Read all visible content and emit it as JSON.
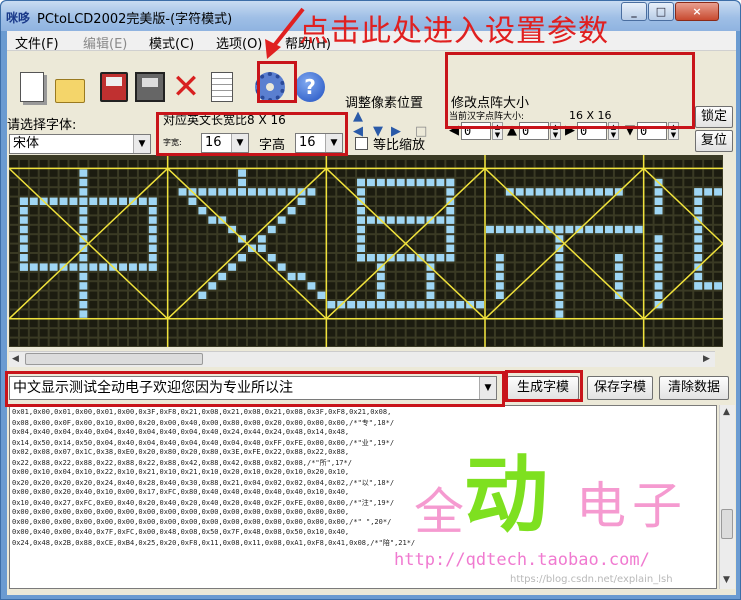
{
  "window": {
    "title": "PCtoLCD2002完美版-(字符模式)",
    "app_icon_text": "咪哆"
  },
  "menu": [
    {
      "label": "文件(F)",
      "enabled": true
    },
    {
      "label": "编辑(E)",
      "enabled": false
    },
    {
      "label": "模式(C)",
      "enabled": true
    },
    {
      "label": "选项(O)",
      "enabled": true
    },
    {
      "label": "帮助(H)",
      "enabled": true
    }
  ],
  "annotation": "点击此处进入设置参数",
  "toolbar_icons": [
    "new-icon",
    "open-icon",
    "save-icon",
    "save-as-icon",
    "delete-icon",
    "notes-icon",
    "settings-gear-icon",
    "help-icon"
  ],
  "font": {
    "label": "请选择字体:",
    "value": "宋体"
  },
  "char_size": {
    "label": "对应英文长宽比8 X 16",
    "width_label": "字宽:",
    "width_value": "16",
    "height_label": "字高",
    "height_value": "16"
  },
  "proportional": {
    "label": "等比缩放",
    "checked": false
  },
  "format_buttons": [
    "B",
    "I",
    "U"
  ],
  "pixel_position": {
    "label": "调整像素位置"
  },
  "matrix_size": {
    "label": "修改点阵大小",
    "current_label": "当前汉字点阵大小:",
    "current_value": "16 X 16",
    "spinners": [
      "0",
      "0",
      "0",
      "0"
    ]
  },
  "buttons": {
    "lock": "锁定",
    "reset": "复位",
    "generate": "生成字模",
    "save": "保存字模",
    "clear": "清除数据"
  },
  "input_text": "中文显示测试全动电子欢迎您因为专业所以注",
  "preview_glyphs": [
    "中",
    "文",
    "显",
    "示",
    "测"
  ],
  "colors": {
    "matrix_bg": "#3a3a24",
    "pixel_on": "#9fd6f4",
    "grid_line": "#f0e23c",
    "highlight": "#c8141a"
  },
  "output_lines": [
    "0x01,0x00,0x01,0x00,0x01,0x00,0x3F,0xF8,0x21,0x08,0x21,0x08,0x21,0x08,0x3F,0xF8,0x21,0x08,",
    "0x08,0x00,0x0F,0x00,0x10,0x00,0x20,0x00,0x40,0x00,0x80,0x00,0x20,0x00,0x00,0x00,/*\"专\",18*/",
    "0x04,0x40,0x04,0x40,0x04,0x40,0x04,0x40,0x04,0x40,0x24,0x44,0x24,0x48,0x14,0x48,",
    "0x14,0x50,0x14,0x50,0x04,0x40,0x04,0x40,0x04,0x40,0x04,0x40,0xFF,0xFE,0x00,0x00,/*\"业\",19*/",
    "0x02,0x08,0x07,0x1C,0x38,0xE0,0x20,0x80,0x20,0x80,0x3E,0xFE,0x22,0x88,0x22,0x88,",
    "0x22,0x88,0x22,0x88,0x22,0x88,0x22,0x88,0x42,0x88,0x42,0x88,0x82,0x08,/*\"所\",17*/",
    "0x00,0x10,0x04,0x10,0x22,0x10,0x21,0x10,0x21,0x10,0x20,0x10,0x20,0x10,0x20,0x10,",
    "0x20,0x20,0x20,0x20,0x24,0x40,0x28,0x40,0x30,0x88,0x21,0x04,0x02,0x02,0x04,0x02,/*\"以\",18*/",
    "0x00,0x80,0x20,0x40,0x10,0x00,0x17,0xFC,0x80,0x40,0x40,0x40,0x40,0x40,0x10,0x40,",
    "0x10,0x40,0x27,0xFC,0xE0,0x40,0x20,0x40,0x20,0x40,0x20,0x40,0x2F,0xFE,0x00,0x00,/*\"注\",19*/",
    "0x00,0x00,0x00,0x00,0x00,0x00,0x00,0x00,0x00,0x00,0x00,0x00,0x00,0x00,0x00,0x00,",
    "0x00,0x00,0x00,0x00,0x00,0x00,0x00,0x00,0x00,0x00,0x00,0x00,0x00,0x00,0x00,0x00,/*\" \",20*/",
    "0x00,0x40,0x00,0x40,0x7F,0xFC,0x00,0x48,0x08,0x50,0x7F,0x48,0x08,0x50,0x10,0x40,",
    "0x24,0x48,0x2B,0x88,0xCE,0xB4,0x25,0x20,0xF8,0x11,0x08,0x11,0x08,0xA1,0xF8,0x41,0x08,/*\"陪\",21*/"
  ],
  "watermark": {
    "chars": [
      "全",
      "动",
      "电",
      "子"
    ],
    "url": "http://qdtech.taobao.com/",
    "csdn": "https://blog.csdn.net/explain_lsh"
  }
}
